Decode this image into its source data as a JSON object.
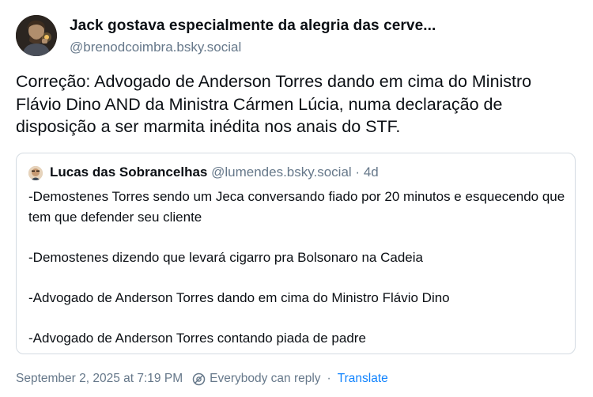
{
  "author": {
    "display_name": "Jack gostava especialmente da alegria das cerve...",
    "handle": "@brenodcoimbra.bsky.social"
  },
  "post_text": "Correção: Advogado de Anderson Torres dando em cima do Ministro Flávio Dino AND da Ministra Cármen Lúcia, numa declaração de disposição a ser marmita inédita nos anais do STF.",
  "quote": {
    "author_name": "Lucas das Sobrancelhas",
    "author_handle": "@lumendes.bsky.social",
    "separator": "·",
    "age": "4d",
    "paragraphs": [
      "-Demostenes Torres sendo um Jeca conversando fiado por 20 minutos e esquecendo que tem que defender seu cliente",
      "-Demostenes dizendo que levará cigarro pra Bolsonaro na Cadeia",
      "-Advogado de Anderson Torres dando em cima do Ministro Flávio Dino",
      "-Advogado de Anderson Torres contando piada de padre"
    ]
  },
  "footer": {
    "timestamp": "September 2, 2025 at 7:19 PM",
    "reply_setting": "Everybody can reply",
    "separator": "·",
    "translate_label": "Translate"
  },
  "icons": {
    "reply_setting": "reply-permission-icon"
  },
  "colors": {
    "muted_text": "#66788a",
    "link": "#1083fe",
    "border": "#d4dbe2"
  }
}
